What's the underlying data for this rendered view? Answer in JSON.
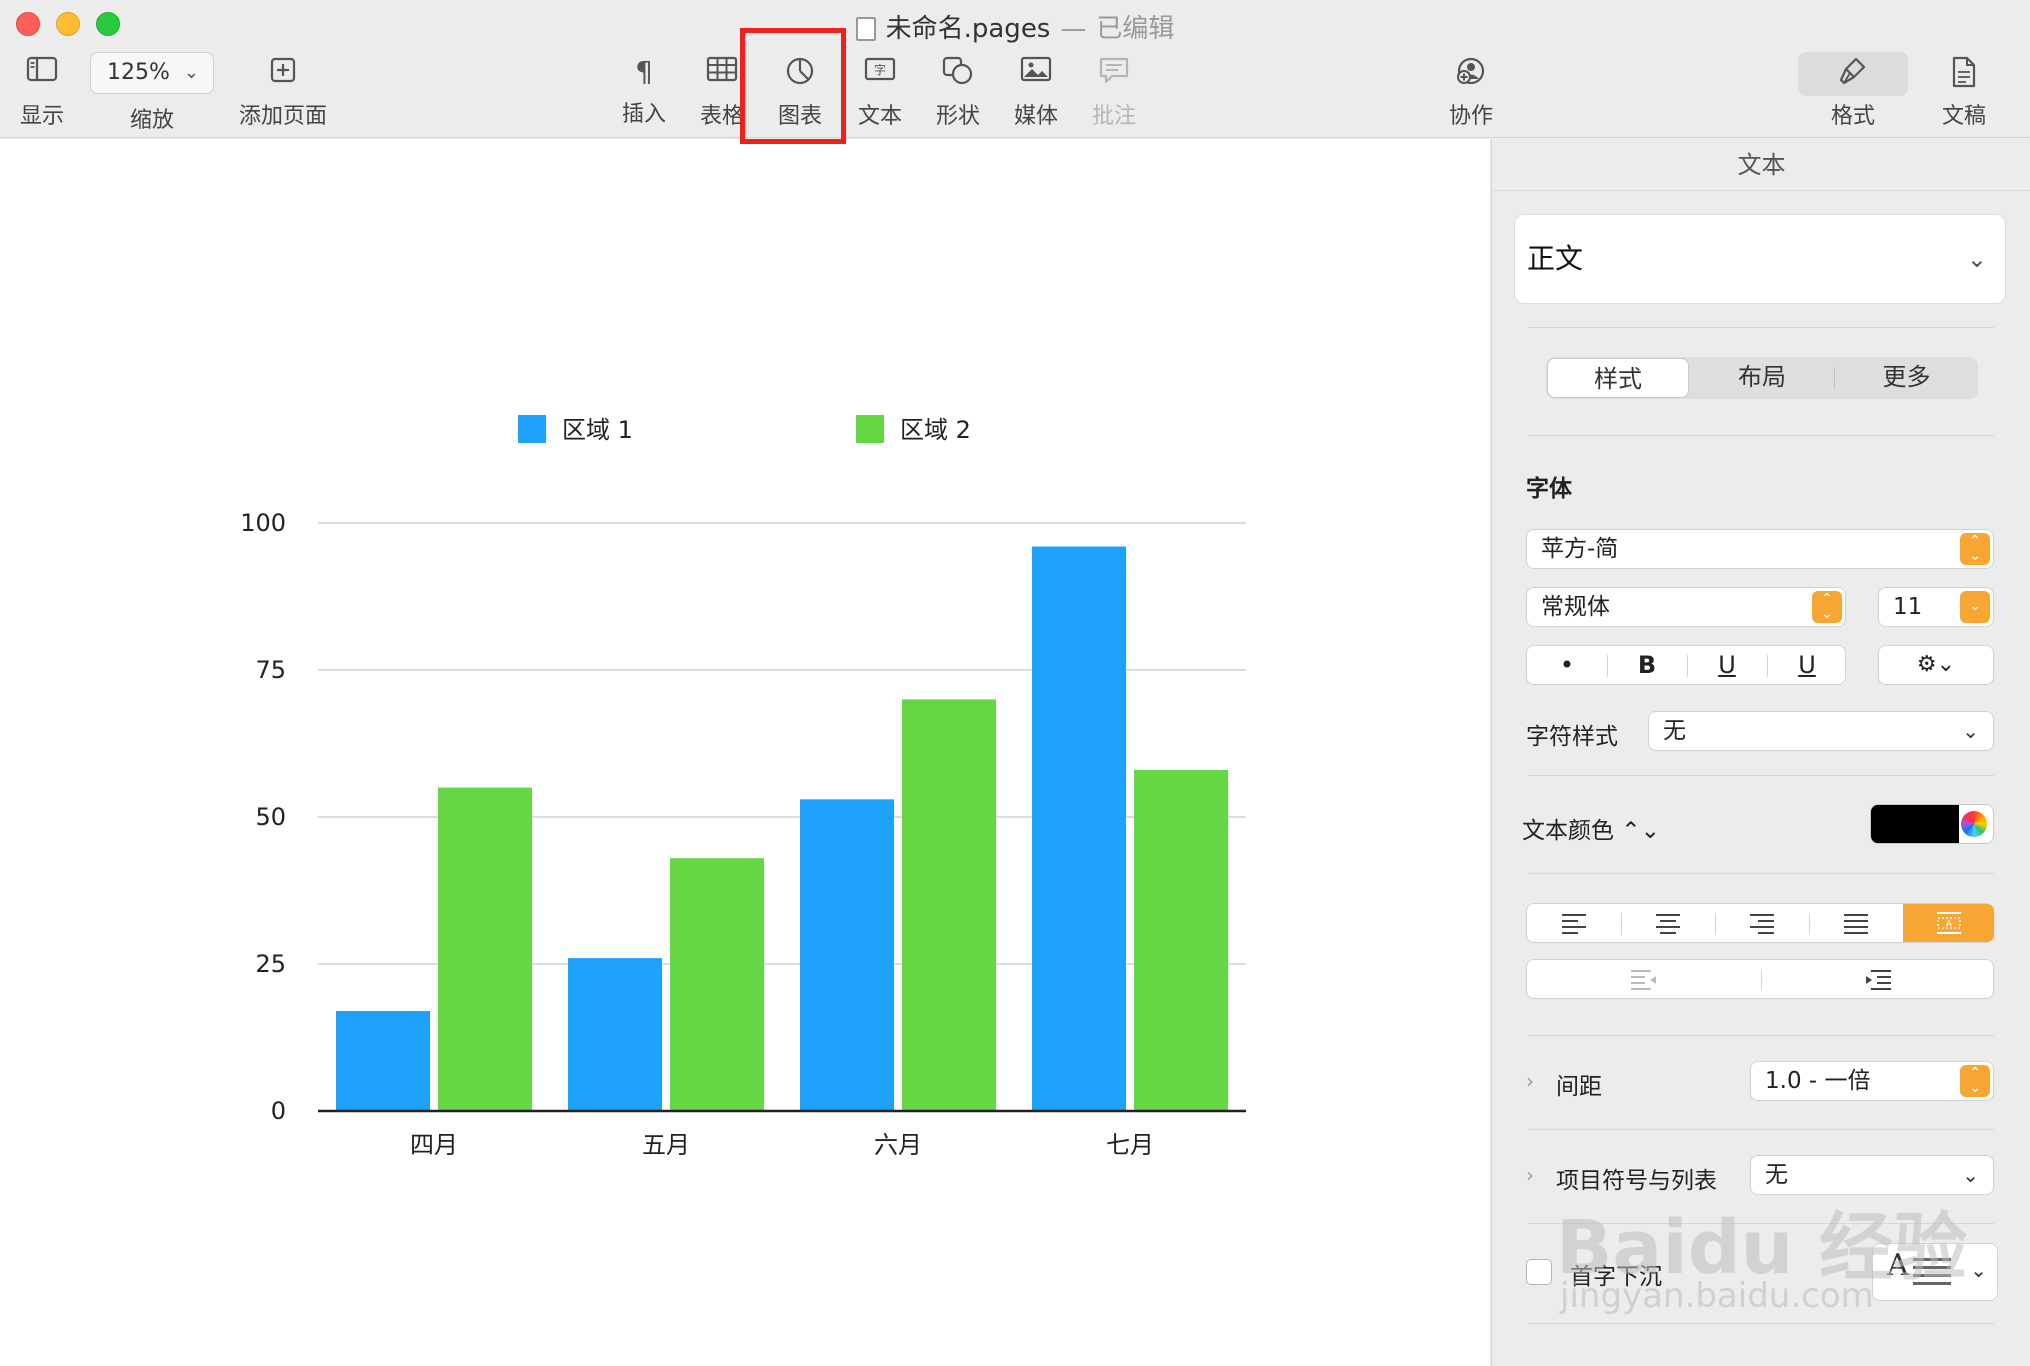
{
  "window": {
    "title": "未命名.pages",
    "title_separator": "—",
    "edited_status": "已编辑"
  },
  "toolbar": {
    "view_label": "显示",
    "zoom_value": "125%",
    "zoom_label": "缩放",
    "add_page_label": "添加页面",
    "insert_label": "插入",
    "table_label": "表格",
    "chart_label": "图表",
    "text_label": "文本",
    "shape_label": "形状",
    "media_label": "媒体",
    "comment_label": "批注",
    "collaborate_label": "协作",
    "format_label": "格式",
    "document_label": "文稿",
    "highlight_color": "#f0201c"
  },
  "chart_data": {
    "type": "bar",
    "categories": [
      "四月",
      "五月",
      "六月",
      "七月"
    ],
    "series": [
      {
        "name": "区域 1",
        "values": [
          17,
          26,
          53,
          96
        ],
        "color": "#1ea1fa"
      },
      {
        "name": "区域 2",
        "values": [
          55,
          43,
          70,
          58
        ],
        "color": "#65d744"
      }
    ],
    "y_ticks": [
      "0",
      "25",
      "50",
      "75",
      "100"
    ],
    "ylim": [
      0,
      100
    ],
    "grid": true,
    "legend_position": "top"
  },
  "sidebar": {
    "header": "文本",
    "paragraph_style": "正文",
    "tabs": [
      "样式",
      "布局",
      "更多"
    ],
    "font_section_label": "字体",
    "font_family": "苹方-简",
    "font_weight": "常规体",
    "font_size": "11",
    "style_buttons": [
      "•",
      "B",
      "U",
      "U"
    ],
    "char_style_label": "字符样式",
    "char_style_value": "无",
    "text_color_label": "文本颜色 ⌃⌄",
    "text_color_value": "#000000",
    "spacing_label": "间距",
    "spacing_value": "1.0 - 一倍",
    "bullets_label": "项目符号与列表",
    "bullets_value": "无",
    "dropcap_label": "首字下沉",
    "dropcap_glyph": "A"
  },
  "watermark": {
    "text": "Baidu 经验",
    "url": "jingyan.baidu.com"
  }
}
